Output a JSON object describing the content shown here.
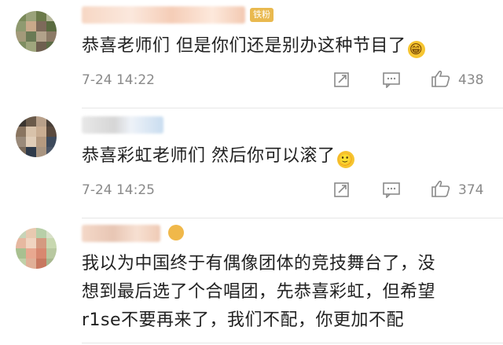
{
  "comments": [
    {
      "fan_badge": "铁粉",
      "text": "恭喜老师们 但是你们还是别办这种节目了",
      "emoji": "grin-emoji",
      "time": "7-24 14:22",
      "likes": "438",
      "avatar_colors": [
        "#7a8a5a",
        "#9aa27a",
        "#6b7a4a",
        "#b5b89a",
        "#8f9a70",
        "#c9a98a",
        "#7d6a5a",
        "#5a6b40",
        "#a39a7a",
        "#6a7a55",
        "#b2a28a",
        "#8c7a66",
        "#7f8e62",
        "#9fa67d",
        "#6e5f4f",
        "#5c6b45"
      ]
    },
    {
      "fan_badge": "",
      "text": "恭喜彩虹老师们 然后你可以滚了",
      "emoji": "smile-emoji",
      "time": "7-24 14:25",
      "likes": "374",
      "avatar_colors": [
        "#3a3530",
        "#6a5a4a",
        "#b8a08a",
        "#4a4038",
        "#8a7560",
        "#d8c2aa",
        "#c9ad92",
        "#5a4a3e",
        "#9a8a7a",
        "#e0cdb8",
        "#b59a80",
        "#3d4a5c",
        "#7a6a5a",
        "#2e3a4a",
        "#a89480",
        "#4a5566"
      ]
    },
    {
      "fan_badge": "",
      "text_lines": [
        "我以为中国终于有偶像团体的竞技舞台了，没",
        "想到最后选了个合唱团，先恭喜彩虹，但希望",
        "r1se不要再来了，我们不配，你更加不配"
      ],
      "avatar_colors": [
        "#c8d4b8",
        "#e8c9b0",
        "#b8cfa8",
        "#d8e0c8",
        "#e6b8a0",
        "#f0d4c0",
        "#d49a80",
        "#c8d8b0",
        "#a8c090",
        "#e8a890",
        "#d88870",
        "#b8c8a0",
        "#c0d0a8",
        "#e0b098",
        "#c87860",
        "#a8b890"
      ]
    }
  ],
  "icons": {
    "forward": "forward-icon",
    "comment": "comment-icon",
    "like": "thumbs-up-icon"
  }
}
